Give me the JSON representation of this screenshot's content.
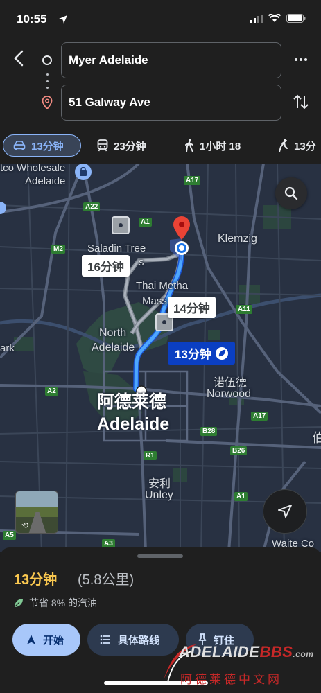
{
  "status_bar": {
    "time": "10:55"
  },
  "header": {
    "origin": "Myer Adelaide",
    "destination": "51 Galway Ave"
  },
  "modes": [
    {
      "icon": "car-icon",
      "label": "13分钟",
      "selected": true
    },
    {
      "icon": "transit-icon",
      "label": "23分钟"
    },
    {
      "icon": "walk-icon",
      "label": "1小时 18"
    },
    {
      "icon": "ride-icon",
      "label": "13分"
    }
  ],
  "map": {
    "labels": {
      "costco": "tco Wholesale",
      "costco2": "Adelaide",
      "klemzig": "Klemzig",
      "saladin": "Saladin Tree",
      "saladin2": "s",
      "thai": "Thai Metha",
      "thai2": "Mass",
      "north1": "North",
      "north2": "Adelaide",
      "park": "ark",
      "norwood_zh": "诺伍德",
      "norwood_en": "Norwood",
      "adelaide_zh": "阿德莱德",
      "adelaide_en": "Adelaide",
      "unley_zh": "安利",
      "unley_en": "Unley",
      "waite": "Waite Co",
      "edge_zh": "伯"
    },
    "roads": [
      "A17",
      "A22",
      "A1",
      "M2",
      "A11",
      "A2",
      "A17",
      "B28",
      "B26",
      "R1",
      "A1",
      "A5",
      "A3"
    ],
    "callouts": {
      "alt1": "16分钟",
      "alt2": "14分钟",
      "primary": "13分钟"
    },
    "colors": {
      "route": "#4ea7ff",
      "alt_route": "#9aa0a6",
      "pin": "#ea4335"
    }
  },
  "sheet": {
    "duration": "13分钟",
    "distance": "(5.8公里)",
    "eco_text": "节省 8% 的汽油",
    "start_label": "开始",
    "steps_label": "具体路线",
    "pin_label": "钉住"
  },
  "watermark": {
    "top_a": "ADELAIDE",
    "top_b": "BBS",
    "top_c": ".com",
    "bottom": "阿德莱德中文网"
  }
}
